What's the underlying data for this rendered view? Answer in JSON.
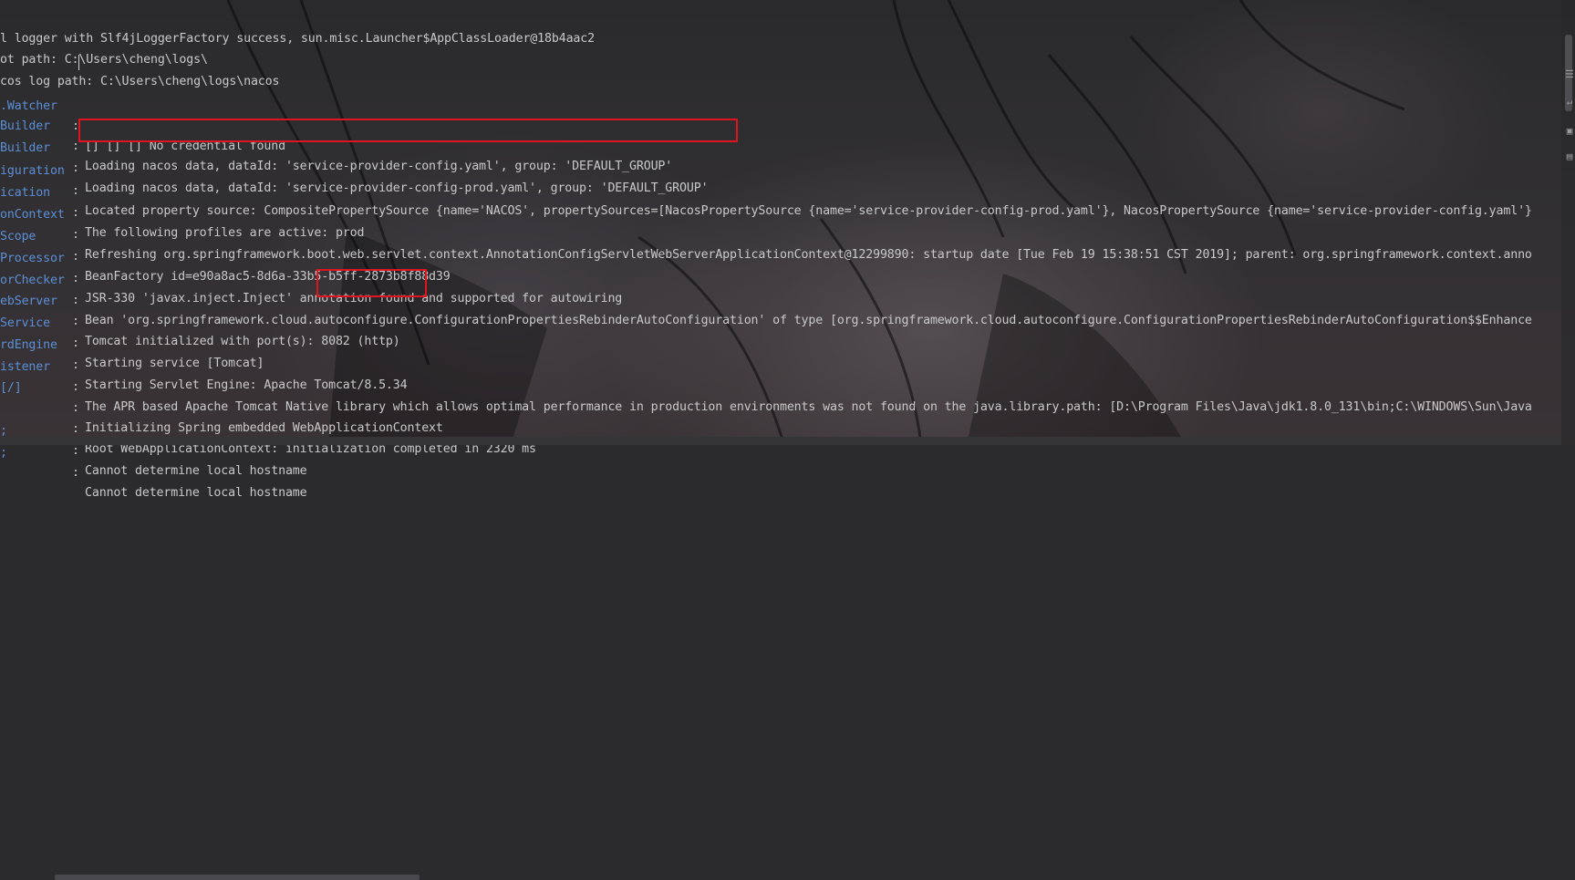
{
  "colors": {
    "background": "#2b2b2d",
    "logger_name": "#5c8fd6",
    "text": "#c9c9c9",
    "highlight_box": "#e0141e"
  },
  "console": {
    "lines": [
      {
        "full": "l logger with Slf4jLoggerFactory success, sun.misc.Launcher$AppClassLoader@18b4aac2"
      },
      {
        "full": "ot path: C:\\Users\\cheng\\logs\\"
      },
      {
        "full": "cos log path: C:\\Users\\cheng\\logs\\nacos"
      },
      {
        "logger": ".Watcher",
        "sep": ":",
        "msg": "[] [] [] No credential found"
      },
      {
        "logger": "Builder",
        "sep": ":",
        "msg": "Loading nacos data, dataId: 'service-provider-config.yaml', group: 'DEFAULT_GROUP'"
      },
      {
        "logger": "Builder",
        "sep": ":",
        "msg": "Loading nacos data, dataId: 'service-provider-config-prod.yaml', group: 'DEFAULT_GROUP'"
      },
      {
        "logger": "iguration",
        "sep": ":",
        "msg": "Located property source: CompositePropertySource {name='NACOS', propertySources=[NacosPropertySource {name='service-provider-config-prod.yaml'}, NacosPropertySource {name='service-provider-config.yaml'}"
      },
      {
        "logger": "ication",
        "sep": ":",
        "msg": "The following profiles are active: prod"
      },
      {
        "logger": "onContext",
        "sep": ":",
        "msg": "Refreshing org.springframework.boot.web.servlet.context.AnnotationConfigServletWebServerApplicationContext@12299890: startup date [Tue Feb 19 15:38:51 CST 2019]; parent: org.springframework.context.anno"
      },
      {
        "logger": "Scope",
        "sep": ":",
        "msg": "BeanFactory id=e90a8ac5-8d6a-33b5-b5ff-2873b8f88d39"
      },
      {
        "logger": "Processor",
        "sep": ":",
        "msg": "JSR-330 'javax.inject.Inject' annotation found and supported for autowiring"
      },
      {
        "logger": "orChecker",
        "sep": ":",
        "msg": "Bean 'org.springframework.cloud.autoconfigure.ConfigurationPropertiesRebinderAutoConfiguration' of type [org.springframework.cloud.autoconfigure.ConfigurationPropertiesRebinderAutoConfiguration$$Enhance"
      },
      {
        "logger": "ebServer",
        "sep": ":",
        "msg": "Tomcat initialized with port(s): 8082 (http)"
      },
      {
        "logger": "Service",
        "sep": ":",
        "msg": "Starting service [Tomcat]"
      },
      {
        "logger": "rdEngine",
        "sep": ":",
        "msg": "Starting Servlet Engine: Apache Tomcat/8.5.34"
      },
      {
        "logger": "istener",
        "sep": ":",
        "msg": "The APR based Apache Tomcat Native library which allows optimal performance in production environments was not found on the java.library.path: [D:\\Program Files\\Java\\jdk1.8.0_131\\bin;C:\\WINDOWS\\Sun\\Java"
      },
      {
        "logger": "[/]",
        "sep": ":",
        "msg": "Initializing Spring embedded WebApplicationContext"
      },
      {
        "logger": "",
        "sep": ":",
        "msg": "Root WebApplicationContext: initialization completed in 2320 ms"
      },
      {
        "logger": ";",
        "sep": ":",
        "msg": "Cannot determine local hostname"
      },
      {
        "logger": ";",
        "sep": ":",
        "msg": "Cannot determine local hostname"
      }
    ]
  }
}
